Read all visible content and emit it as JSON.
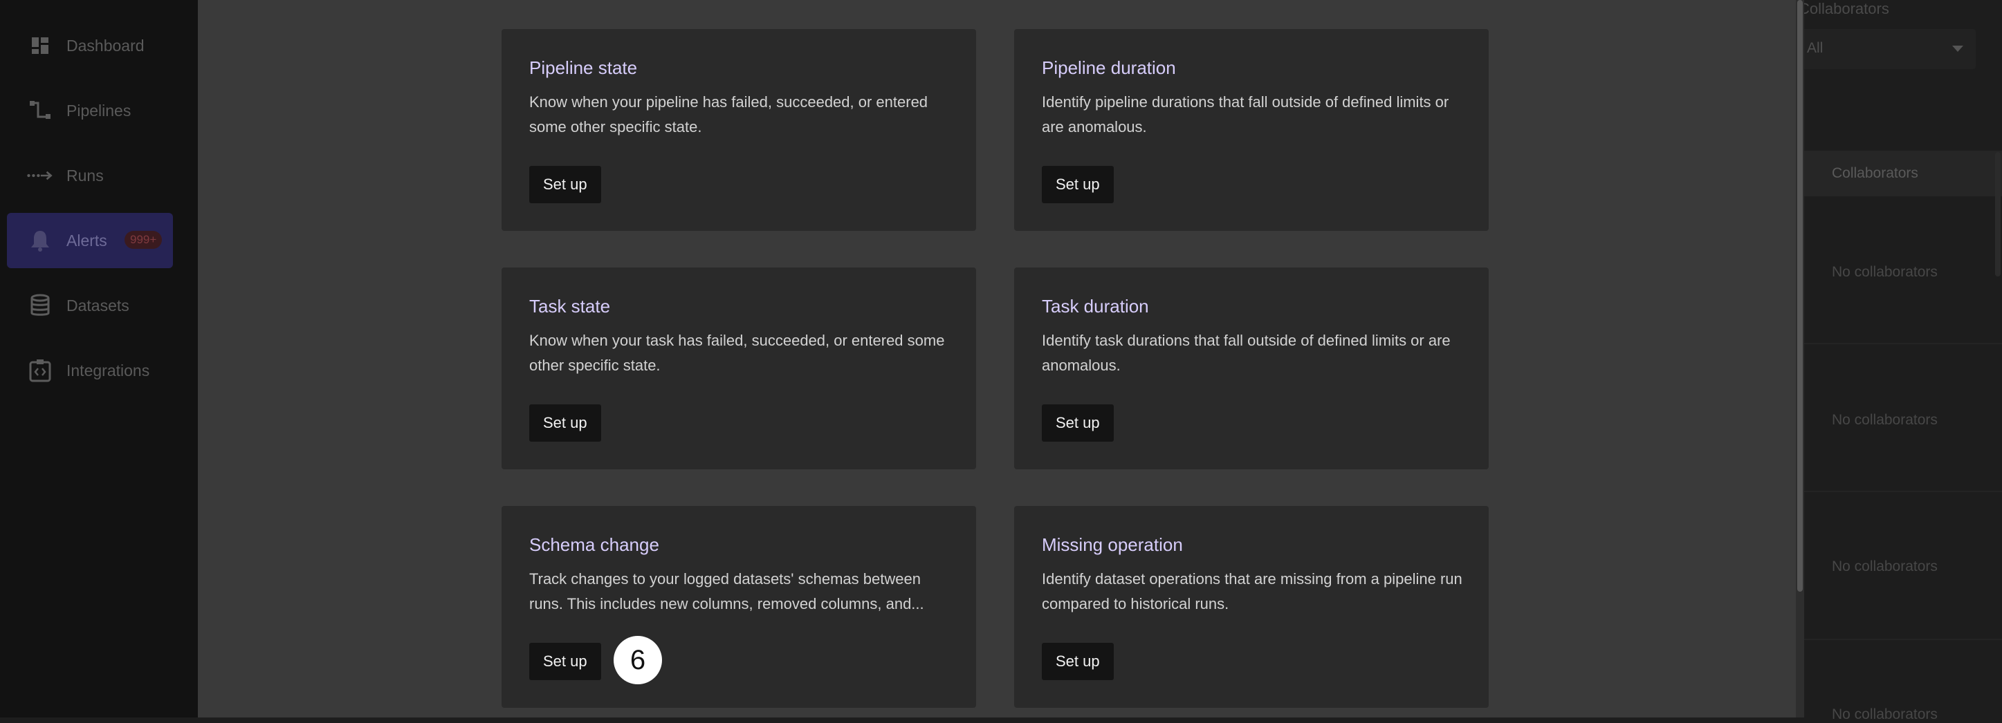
{
  "sidebar": {
    "items": [
      {
        "label": "Dashboard",
        "icon": "dashboard-icon"
      },
      {
        "label": "Pipelines",
        "icon": "pipelines-icon"
      },
      {
        "label": "Runs",
        "icon": "runs-icon"
      },
      {
        "label": "Alerts",
        "icon": "bell-icon",
        "badge": "999+",
        "active": true
      },
      {
        "label": "Datasets",
        "icon": "database-icon"
      },
      {
        "label": "Integrations",
        "icon": "integrations-icon"
      }
    ]
  },
  "background": {
    "filter_label": "Collaborators",
    "filter_value": "All",
    "column_header": "Collaborators",
    "rows": [
      "No collaborators",
      "No collaborators",
      "No collaborators",
      "No collaborators"
    ]
  },
  "modal": {
    "cards": [
      {
        "title": "Pipeline state",
        "description": "Know when your pipeline has failed, succeeded, or entered some other specific state.",
        "button": "Set up"
      },
      {
        "title": "Pipeline duration",
        "description": "Identify pipeline durations that fall outside of defined limits or are anomalous.",
        "button": "Set up"
      },
      {
        "title": "Task state",
        "description": "Know when your task has failed, succeeded, or entered some other specific state.",
        "button": "Set up"
      },
      {
        "title": "Task duration",
        "description": "Identify task durations that fall outside of defined limits or are anomalous.",
        "button": "Set up"
      },
      {
        "title": "Schema change",
        "description": "Track changes to your logged datasets' schemas between runs. This includes new columns, removed columns, and...",
        "button": "Set up"
      },
      {
        "title": "Missing operation",
        "description": "Identify dataset operations that are missing from a pipeline run compared to historical runs.",
        "button": "Set up"
      }
    ],
    "step_marker": "6"
  },
  "colors": {
    "card_title": "#d7cdfb",
    "active_nav": "#262354",
    "modal_bg": "#3a3a3a",
    "card_bg": "#2a2a2a"
  }
}
